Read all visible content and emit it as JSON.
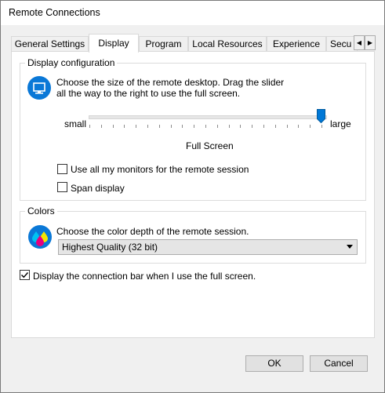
{
  "window": {
    "title": "Remote Connections"
  },
  "tabs": [
    {
      "label": "General Settings"
    },
    {
      "label": "Display"
    },
    {
      "label": "Program"
    },
    {
      "label": "Local Resources"
    },
    {
      "label": "Experience"
    },
    {
      "label": "Secu"
    }
  ],
  "active_tab": "Display",
  "display_group": {
    "label": "Display configuration",
    "description_line1": "Choose the size of the remote desktop. Drag the slider",
    "description_line2": "all the way to the right to use the full screen.",
    "slider": {
      "min_label": "small",
      "max_label": "large",
      "value_label": "Full Screen",
      "value": 1.0
    },
    "monitors_checkbox": {
      "label": "Use all my monitors for the remote session",
      "checked": false
    },
    "span_checkbox": {
      "label": "Span display",
      "checked": false
    }
  },
  "colors_group": {
    "label": "Colors",
    "description": "Choose the color depth of the remote session.",
    "select_value": "Highest Quality (32 bit)"
  },
  "connection_bar_checkbox": {
    "label": "Display the connection bar when I use the full screen.",
    "checked": true
  },
  "buttons": {
    "ok": "OK",
    "cancel": "Cancel"
  },
  "colors": {
    "accent": "#0078d7",
    "panel_bg": "#ffffff",
    "window_bg": "#f0f0f0"
  },
  "icons": {
    "monitor": "monitor-icon",
    "colors": "color-depth-icon",
    "scroll_left": "chevron-left-icon",
    "scroll_right": "chevron-right-icon"
  }
}
